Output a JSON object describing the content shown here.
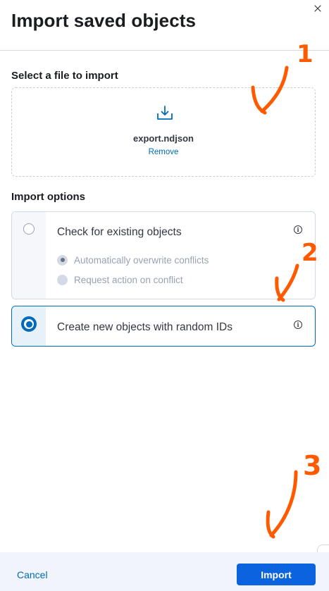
{
  "flyout": {
    "title": "Import saved objects",
    "close_icon": "close-icon"
  },
  "file_section": {
    "label": "Select a file to import",
    "upload_icon": "upload-icon",
    "file_name": "export.ndjson",
    "remove_label": "Remove"
  },
  "import_options": {
    "label": "Import options",
    "check_existing": {
      "label": "Check for existing objects",
      "selected": false,
      "sub_options": [
        {
          "label": "Automatically overwrite conflicts",
          "selected": true,
          "disabled": true
        },
        {
          "label": "Request action on conflict",
          "selected": false,
          "disabled": true
        }
      ]
    },
    "create_new": {
      "label": "Create new objects with random IDs",
      "selected": true
    }
  },
  "footer": {
    "cancel_label": "Cancel",
    "import_label": "Import"
  },
  "annotations": {
    "color": "#ff5a00",
    "numbers": [
      "1",
      "2",
      "3"
    ]
  },
  "colors": {
    "primary": "#0b64dd",
    "link": "#006bb8",
    "border": "#d3dae6"
  }
}
